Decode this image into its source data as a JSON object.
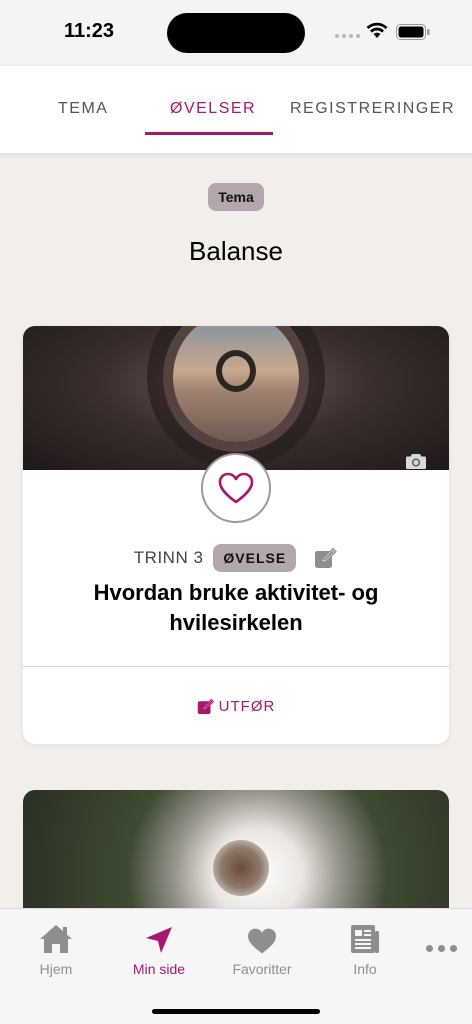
{
  "status_bar": {
    "time": "11:23"
  },
  "tabs": [
    {
      "label": "TEMA"
    },
    {
      "label": "ØVELSER"
    },
    {
      "label": "REGISTRERINGER"
    }
  ],
  "header": {
    "badge": "Tema",
    "title": "Balanse"
  },
  "card": {
    "step": "TRINN 3",
    "type_badge": "ØVELSE",
    "title_line1": "Hvordan bruke aktivitet- og",
    "title_line2": "hvilesirkelen",
    "action_label": "UTFØR"
  },
  "tabbar": [
    {
      "label": "Hjem",
      "icon": "home-icon"
    },
    {
      "label": "Min side",
      "icon": "navigation-arrow-icon"
    },
    {
      "label": "Favoritter",
      "icon": "heart-icon"
    },
    {
      "label": "Info",
      "icon": "newspaper-icon"
    }
  ],
  "colors": {
    "accent": "#a8176a",
    "badge": "#b3a7ad",
    "background": "#f2efeb"
  }
}
